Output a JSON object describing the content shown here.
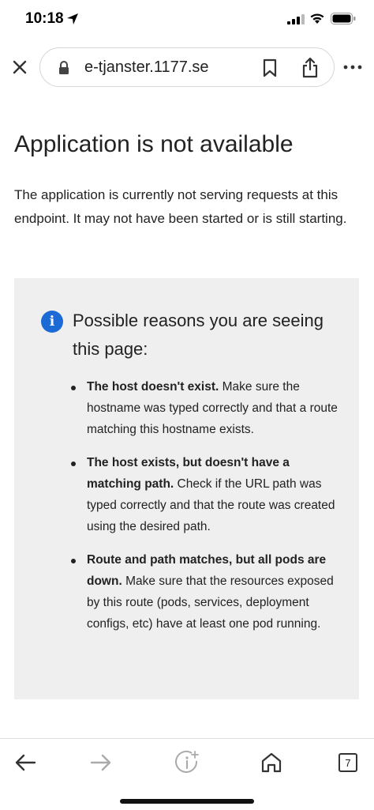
{
  "status_bar": {
    "time": "10:18"
  },
  "browser": {
    "url": "e-tjanster.1177.se",
    "tabs_count": "7"
  },
  "page": {
    "title": "Application is not available",
    "intro": "The application is currently not serving requests at this endpoint. It may not have been started or is still starting.",
    "panel_heading": "Possible reasons you are seeing this page:",
    "reasons": [
      {
        "bold": "The host doesn't exist.",
        "text": " Make sure the hostname was typed correctly and that a route matching this hostname exists."
      },
      {
        "bold": "The host exists, but doesn't have a matching path.",
        "text": " Check if the URL path was typed correctly and that the route was created using the desired path."
      },
      {
        "bold": "Route and path matches, but all pods are down.",
        "text": " Make sure that the resources exposed by this route (pods, services, deployment configs, etc) have at least one pod running."
      }
    ]
  },
  "colors": {
    "info_blue": "#1b6ad6",
    "panel_bg": "#efefef"
  }
}
